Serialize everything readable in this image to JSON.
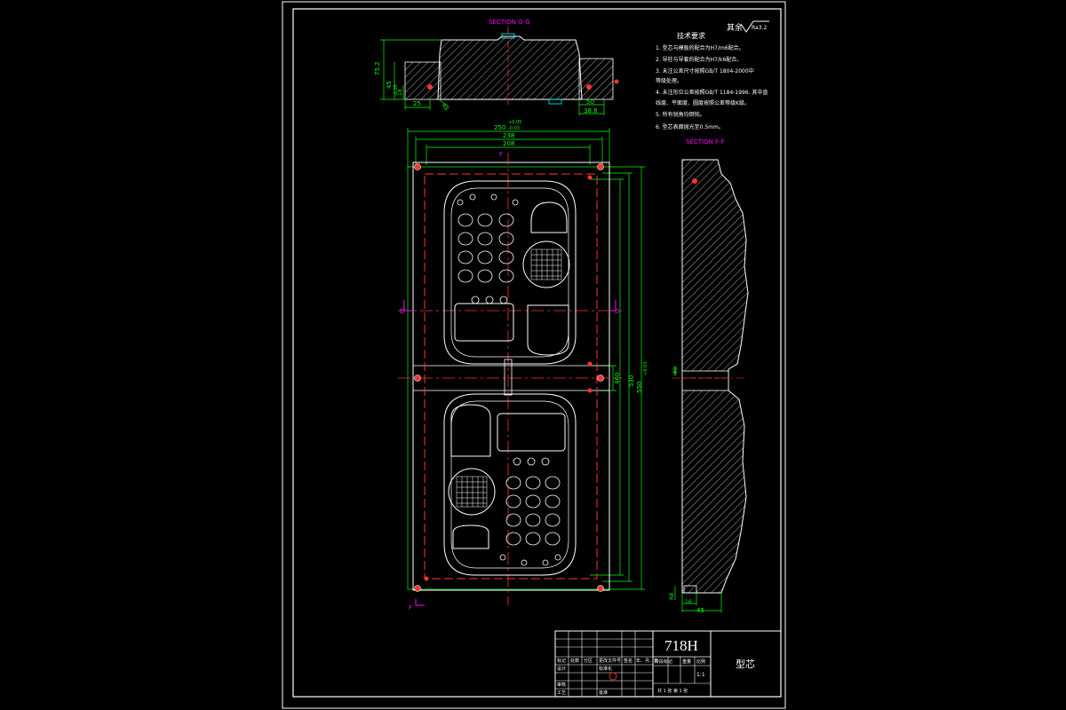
{
  "sheet": {
    "surface_finish_label": "其余",
    "surface_finish_value": "Ra3.2"
  },
  "sections": {
    "section_g_label": "SECTION G-G",
    "section_f_label": "SECTION F-F",
    "cut_marker_f": "F",
    "cut_marker_d": "D"
  },
  "technical_requirements": {
    "title": "技术要求",
    "items": [
      "1. 型芯与模板的配合为H7/m6配合。",
      "2. 导柱与导套的配合为H7/k6配合。",
      "3. 未注公差尺寸按照GB/T 1804-2000中",
      "   等级处理。",
      "4. 未注形位公差按照GB/T 1184-1996. 其中直",
      "   线度、平面度、圆度按照公差等级K级。",
      "5. 所有锐角均倒钝。",
      "6. 型芯表面抛光至0.5mm。"
    ]
  },
  "dimensions": {
    "top_width": "250",
    "top_width_tol_upper": "+0.05",
    "top_width_tol_lower": "-0.03",
    "inner_width_1": "238",
    "inner_width_2": "208",
    "height_1": "460",
    "height_2": "530",
    "height_3": "550",
    "height_3_tol": "+0.03",
    "gg_height": "75.2",
    "gg_step": "45",
    "gg_step_tol": "-0.05",
    "gg_sub": "18",
    "gg_bottom_left": "25",
    "gg_bottom_right_1": "50",
    "gg_bottom_right_2": "38.8",
    "gg_angle": "R8",
    "ff_width": "45",
    "ff_small": "16",
    "ff_side": "R8",
    "ff_mid": "Φ8"
  },
  "title_block": {
    "material": "718H",
    "part_name": "型芯",
    "rows": [
      "标记",
      "处数",
      "分区",
      "更改文件号",
      "签名",
      "年、月、日"
    ],
    "design_row": [
      "设计",
      "",
      "标准化",
      ""
    ],
    "check_row": [
      "审核",
      ""
    ],
    "process_row": [
      "工艺",
      "",
      "批准",
      ""
    ],
    "stage_labels": [
      "阶段标记",
      "重量",
      "比例"
    ],
    "scale": "1:1",
    "sheet_info": "共 1 张  第 1 张"
  },
  "colors": {
    "background": "#000000",
    "outline": "#ffffff",
    "dimension": "#00ff00",
    "centerline": "#ff3333",
    "section_label": "#ff00ff",
    "hatch": "#ffffff",
    "text": "#ffff66",
    "cyan": "#00ffff"
  }
}
